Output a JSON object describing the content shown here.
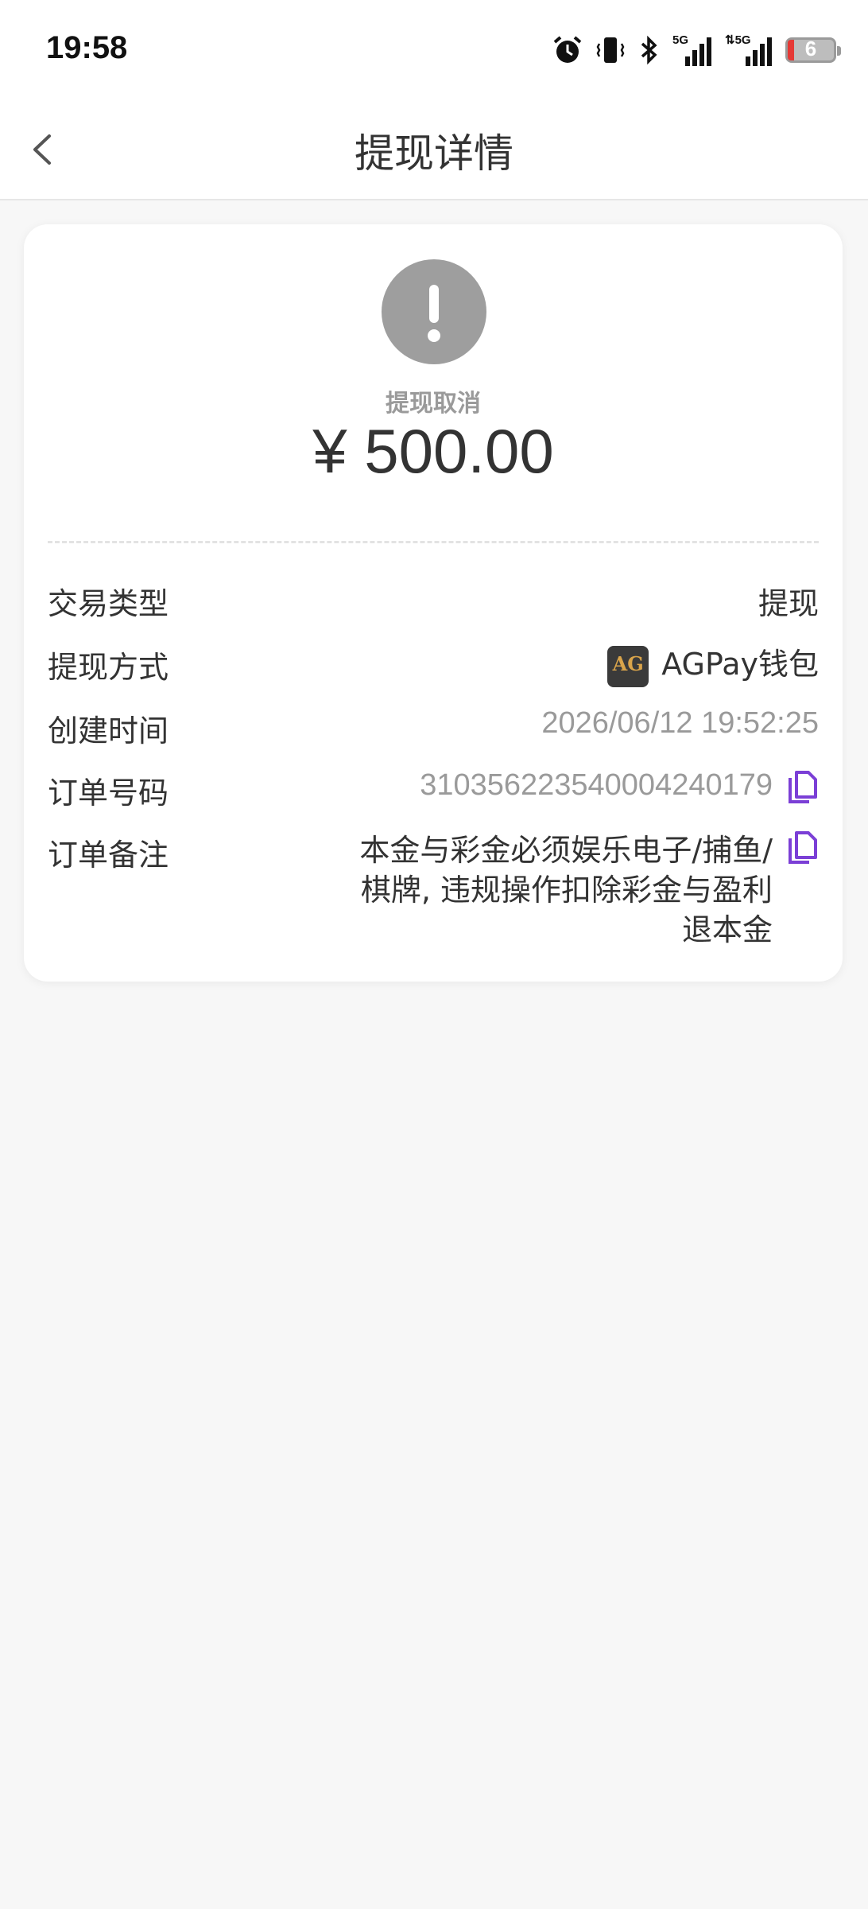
{
  "status_bar": {
    "time": "19:58",
    "icons": [
      "alarm-icon",
      "vibrate-icon",
      "bluetooth-icon",
      "signal-5g-icon",
      "signal-5g-icon"
    ],
    "battery_level": "6"
  },
  "nav": {
    "title": "提现详情",
    "back_icon": "chevron-left-icon"
  },
  "summary": {
    "status_icon": "exclamation-icon",
    "status_text": "提现取消",
    "amount": "¥ 500.00"
  },
  "details": {
    "type_label": "交易类型",
    "type_value": "提现",
    "method_label": "提现方式",
    "method_value": "AGPay钱包",
    "method_logo_text": "AG",
    "created_label": "创建时间",
    "created_value": "2026/06/12 19:52:25",
    "order_label": "订单号码",
    "order_value": "31035622354000424017​9",
    "remark_label": "订单备注",
    "remark_value": "本金与彩金必须娱乐电子/捕鱼/棋牌, 违规操作扣除彩金与盈利 退本金"
  },
  "colors": {
    "accent": "#7b3fd6",
    "status_gray": "#9e9e9e",
    "background": "#f7f7f7"
  }
}
